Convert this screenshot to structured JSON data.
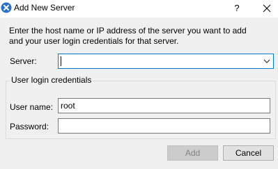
{
  "window": {
    "title": "Add New Server",
    "help_glyph": "?",
    "icon": "server-x-icon"
  },
  "description": {
    "line1": "Enter the host name or IP address of the server you want to add",
    "line2": "and your user login credentials for that server."
  },
  "server": {
    "label": "Server:",
    "value": ""
  },
  "credentials": {
    "group_label": "User login credentials",
    "username_label": "User name:",
    "username_value": "root",
    "password_label": "Password:",
    "password_value": ""
  },
  "buttons": {
    "add_label": "Add",
    "add_enabled": false,
    "cancel_label": "Cancel"
  },
  "colors": {
    "app_icon": "#2a6fc8",
    "focus_border": "#0078d7",
    "disabled_text": "#838383"
  }
}
